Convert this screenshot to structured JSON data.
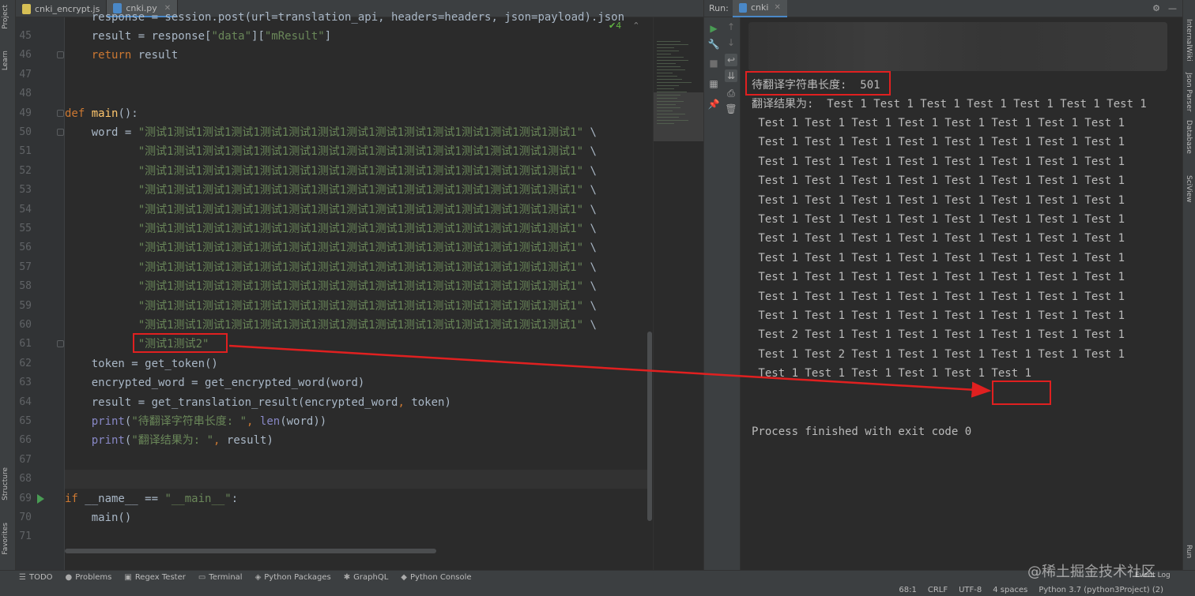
{
  "left_strip": {
    "tabs": [
      "Project",
      "Learn",
      "Structure",
      "Favorites"
    ]
  },
  "editor": {
    "tabs": [
      {
        "label": "cnki_encrypt.js",
        "active": false
      },
      {
        "label": "cnki.py",
        "active": true
      }
    ],
    "inspection_count": "4",
    "line_numbers": [
      "45",
      "46",
      "47",
      "48",
      "49",
      "50",
      "51",
      "52",
      "53",
      "54",
      "55",
      "56",
      "57",
      "58",
      "59",
      "60",
      "61",
      "62",
      "63",
      "64",
      "65",
      "66",
      "67",
      "68",
      "69",
      "70",
      "71"
    ],
    "top_partial_line": "    response = session.post(url=translation_api, headers=headers, json=payload).json",
    "lines": {
      "l45": {
        "indent": "    ",
        "text": "result = response[",
        "s1": "\"data\"",
        "mid": "][",
        "s2": "\"mResult\"",
        "end": "]"
      },
      "l46": {
        "kw": "return",
        "rest": " result"
      },
      "l49": {
        "kw": "def",
        "fn": "main",
        "rest": "():"
      },
      "l50": {
        "pre": "    word = ",
        "str": "\"测试1测试1测试1测试1测试1测试1测试1测试1测试1测试1测试1测试1测试1测试1测试1\"",
        "cont": " \\"
      },
      "cont_str": "\"测试1测试1测试1测试1测试1测试1测试1测试1测试1测试1测试1测试1测试1测试1测试1\"",
      "cont_tail": " \\",
      "l61": {
        "str": "\"测试1测试2\""
      },
      "l62": {
        "text": "token = get_token()"
      },
      "l63": {
        "text": "encrypted_word = get_encrypted_word(word)"
      },
      "l64": {
        "a": "result = get_translation_result(encrypted_word",
        "comma": ",",
        "b": " token)"
      },
      "l65": {
        "fn": "print",
        "open": "(",
        "str": "\"待翻译字符串长度: \"",
        "comma": ", ",
        "len": "len",
        "rest": "(word))"
      },
      "l66": {
        "fn": "print",
        "open": "(",
        "str": "\"翻译结果为: \"",
        "comma": ", ",
        "rest": "result)"
      },
      "l69": {
        "kw": "if",
        "a": " __name__ == ",
        "str": "\"__main__\"",
        "end": ":"
      },
      "l70": {
        "text": "main()"
      }
    }
  },
  "run": {
    "label": "Run:",
    "tab": "cnki",
    "console": {
      "length_line": "待翻译字符串长度:  501",
      "result_first": "翻译结果为:  Test 1 Test 1 Test 1 Test 1 Test 1 Test 1 Test 1",
      "result_lines": [
        " Test 1 Test 1 Test 1 Test 1 Test 1 Test 1 Test 1 Test 1",
        " Test 1 Test 1 Test 1 Test 1 Test 1 Test 1 Test 1 Test 1",
        " Test 1 Test 1 Test 1 Test 1 Test 1 Test 1 Test 1 Test 1",
        " Test 1 Test 1 Test 1 Test 1 Test 1 Test 1 Test 1 Test 1",
        " Test 1 Test 1 Test 1 Test 1 Test 1 Test 1 Test 1 Test 1",
        " Test 1 Test 1 Test 1 Test 1 Test 1 Test 1 Test 1 Test 1",
        " Test 1 Test 1 Test 1 Test 1 Test 1 Test 1 Test 1 Test 1",
        " Test 1 Test 1 Test 1 Test 1 Test 1 Test 1 Test 1 Test 1",
        " Test 1 Test 1 Test 1 Test 1 Test 1 Test 1 Test 1 Test 1",
        " Test 1 Test 1 Test 1 Test 1 Test 1 Test 1 Test 1 Test 1",
        " Test 1 Test 1 Test 1 Test 1 Test 1 Test 1 Test 1 Test 1",
        " Test 2 Test 1 Test 1 Test 1 Test 1 Test 1 Test 1 Test 1",
        " Test 1 Test 2 Test 1 Test 1 Test 1 Test 1 Test 1 Test 1",
        " Test 1 Test 1 Test 1 Test 1 Test 1 Test 1"
      ],
      "exit_line": "Process finished with exit code 0"
    }
  },
  "right_strip": {
    "tabs": [
      "InternalWiki",
      "Json Parser",
      "Database",
      "SciView",
      "Run"
    ]
  },
  "bottom_tools": [
    {
      "icon": "list-icon",
      "label": "TODO"
    },
    {
      "icon": "problems-icon",
      "label": "Problems"
    },
    {
      "icon": "regex-icon",
      "label": "Regex Tester"
    },
    {
      "icon": "terminal-icon",
      "label": "Terminal"
    },
    {
      "icon": "packages-icon",
      "label": "Python Packages"
    },
    {
      "icon": "graphql-icon",
      "label": "GraphQL"
    },
    {
      "icon": "console-icon",
      "label": "Python Console"
    }
  ],
  "event_log": "Event Log",
  "status": {
    "position": "68:1",
    "line_sep": "CRLF",
    "encoding": "UTF-8",
    "indent": "4 spaces",
    "interpreter": "Python 3.7 (python3Project) (2)"
  },
  "watermark": "@稀土掘金技术社区",
  "colors": {
    "highlight": "#e02020",
    "keyword": "#cc7832",
    "string": "#6a8759",
    "function": "#ffc66d",
    "builtin": "#8888c6"
  }
}
